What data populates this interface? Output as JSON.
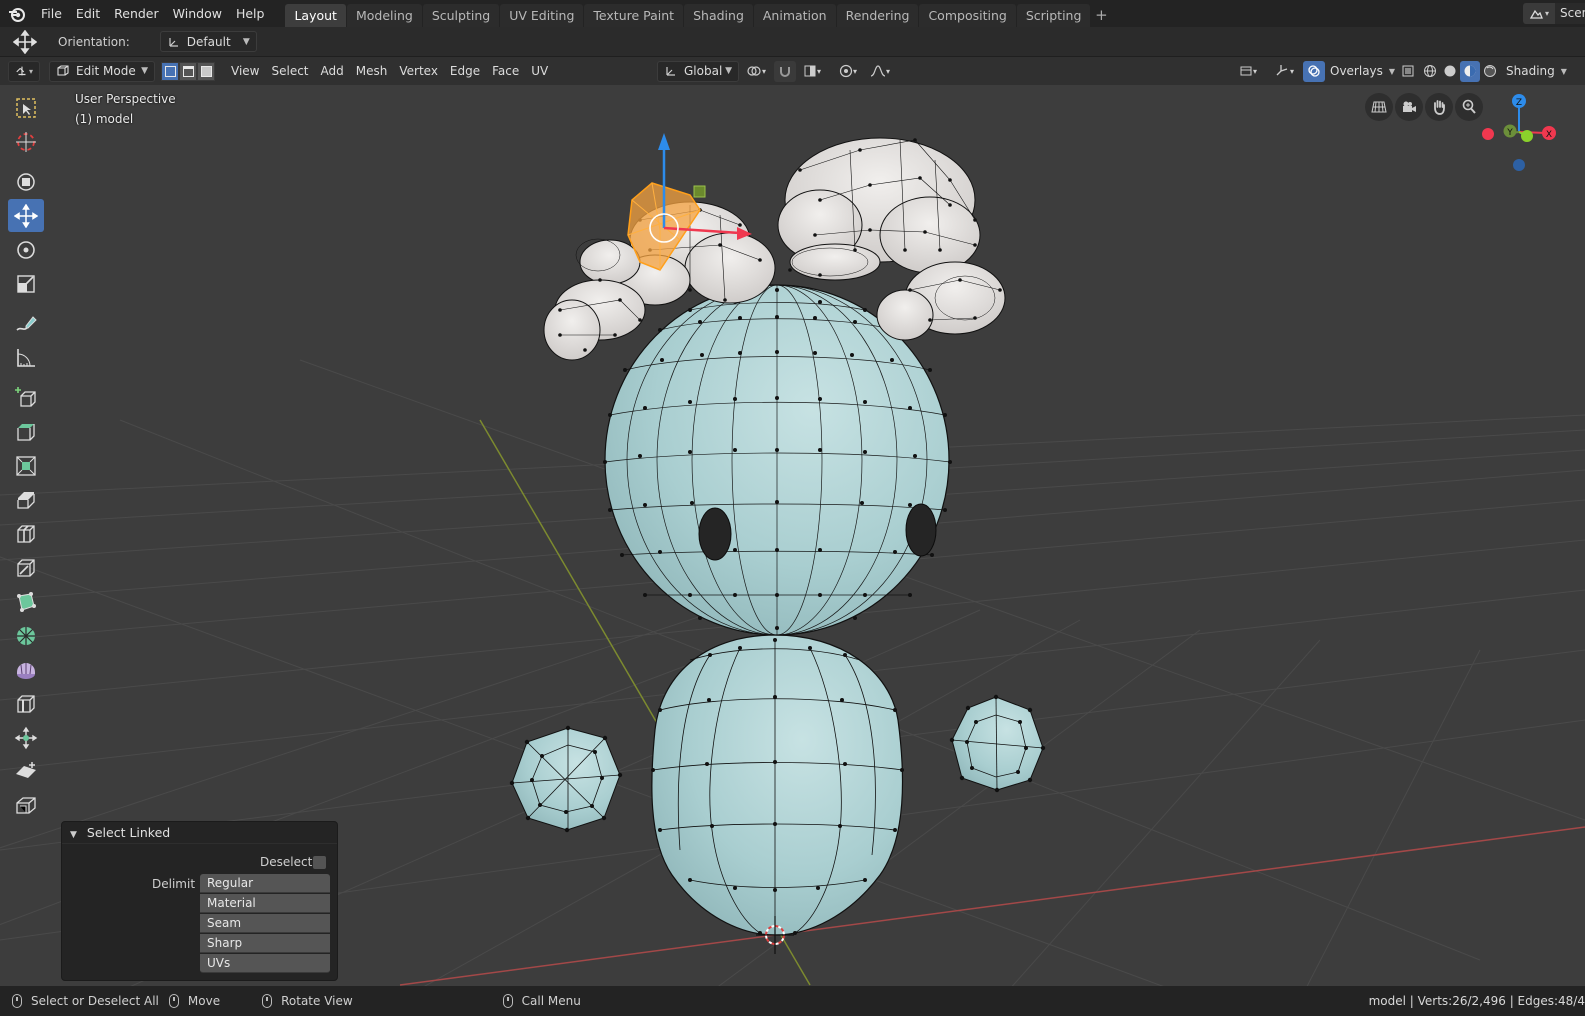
{
  "app_menu": {
    "items": [
      "File",
      "Edit",
      "Render",
      "Window",
      "Help"
    ]
  },
  "workspace_tabs": [
    "Layout",
    "Modeling",
    "Sculpting",
    "UV Editing",
    "Texture Paint",
    "Shading",
    "Animation",
    "Rendering",
    "Compositing",
    "Scripting"
  ],
  "active_tab": "Layout",
  "scene": {
    "name": "Scen"
  },
  "tool_settings": {
    "orientation_label": "Orientation:",
    "orientation_value": "Default"
  },
  "viewport_header": {
    "mode": "Edit Mode",
    "menus": [
      "View",
      "Select",
      "Add",
      "Mesh",
      "Vertex",
      "Edge",
      "Face",
      "UV"
    ],
    "transform_orientation": "Global",
    "overlays_label": "Overlays",
    "shading_label": "Shading"
  },
  "viewport": {
    "perspective": "User Perspective",
    "object": "(1) model"
  },
  "gizmo": {
    "x": "X",
    "y": "Y",
    "z": "Z"
  },
  "operator_panel": {
    "title": "Select Linked",
    "deselect_label": "Deselect",
    "deselect_checked": false,
    "delimit_label": "Delimit",
    "delimit_options": [
      "Regular",
      "Material",
      "Seam",
      "Sharp",
      "UVs"
    ]
  },
  "statusbar": {
    "select": "Select or Deselect All",
    "move": "Move",
    "rotate": "Rotate View",
    "call_menu": "Call Menu",
    "stats": "model | Verts:26/2,496 | Edges:48/4"
  },
  "colors": {
    "accent": "#4772b3",
    "mesh_body": "#a9ced0",
    "mesh_cloud": "#e2dfdd",
    "selection": "#f5a340",
    "axis_x": "#f0384f",
    "axis_y": "#8bd12b",
    "axis_z": "#2d8ceb"
  }
}
